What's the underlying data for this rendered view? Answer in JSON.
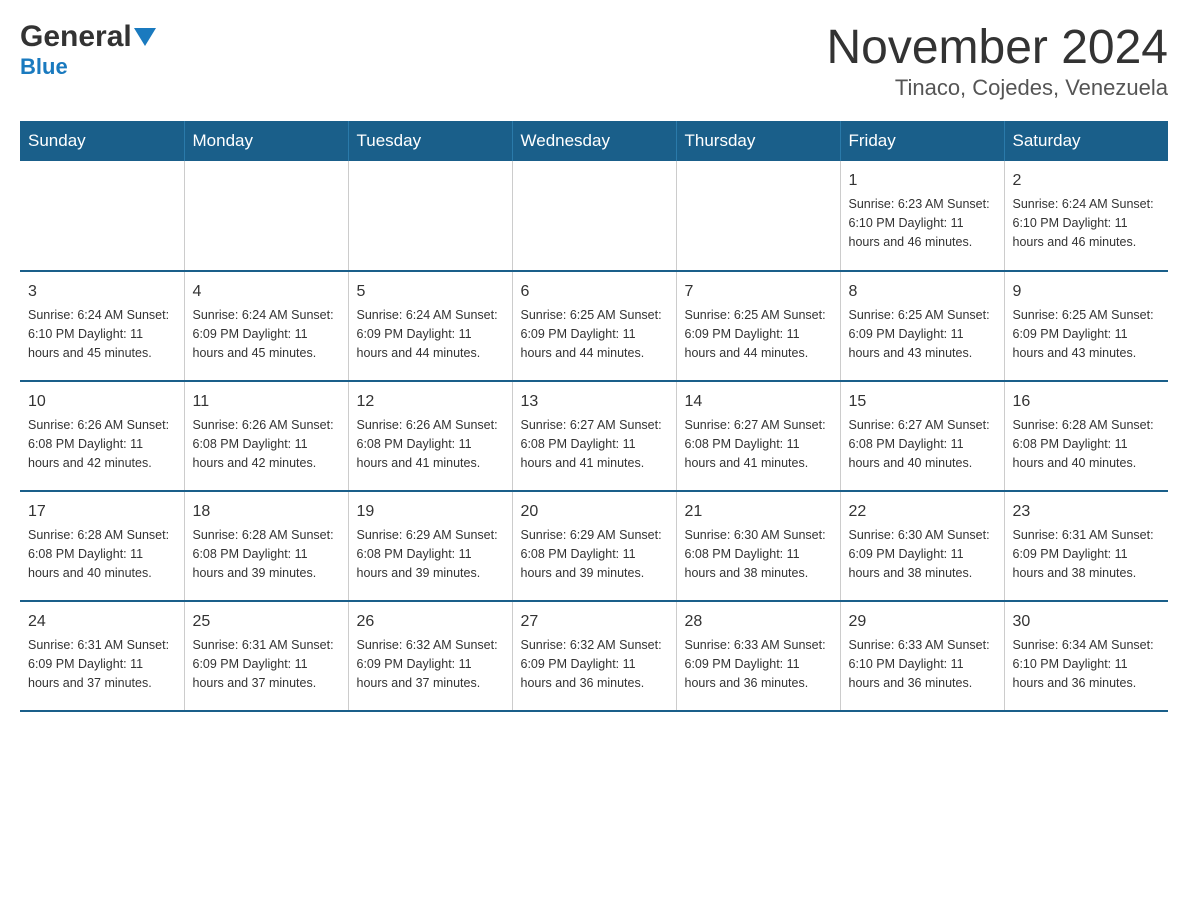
{
  "header": {
    "logo_general": "General",
    "logo_blue": "Blue",
    "month_year": "November 2024",
    "location": "Tinaco, Cojedes, Venezuela"
  },
  "days_of_week": [
    "Sunday",
    "Monday",
    "Tuesday",
    "Wednesday",
    "Thursday",
    "Friday",
    "Saturday"
  ],
  "weeks": [
    [
      {
        "day": "",
        "info": ""
      },
      {
        "day": "",
        "info": ""
      },
      {
        "day": "",
        "info": ""
      },
      {
        "day": "",
        "info": ""
      },
      {
        "day": "",
        "info": ""
      },
      {
        "day": "1",
        "info": "Sunrise: 6:23 AM\nSunset: 6:10 PM\nDaylight: 11 hours\nand 46 minutes."
      },
      {
        "day": "2",
        "info": "Sunrise: 6:24 AM\nSunset: 6:10 PM\nDaylight: 11 hours\nand 46 minutes."
      }
    ],
    [
      {
        "day": "3",
        "info": "Sunrise: 6:24 AM\nSunset: 6:10 PM\nDaylight: 11 hours\nand 45 minutes."
      },
      {
        "day": "4",
        "info": "Sunrise: 6:24 AM\nSunset: 6:09 PM\nDaylight: 11 hours\nand 45 minutes."
      },
      {
        "day": "5",
        "info": "Sunrise: 6:24 AM\nSunset: 6:09 PM\nDaylight: 11 hours\nand 44 minutes."
      },
      {
        "day": "6",
        "info": "Sunrise: 6:25 AM\nSunset: 6:09 PM\nDaylight: 11 hours\nand 44 minutes."
      },
      {
        "day": "7",
        "info": "Sunrise: 6:25 AM\nSunset: 6:09 PM\nDaylight: 11 hours\nand 44 minutes."
      },
      {
        "day": "8",
        "info": "Sunrise: 6:25 AM\nSunset: 6:09 PM\nDaylight: 11 hours\nand 43 minutes."
      },
      {
        "day": "9",
        "info": "Sunrise: 6:25 AM\nSunset: 6:09 PM\nDaylight: 11 hours\nand 43 minutes."
      }
    ],
    [
      {
        "day": "10",
        "info": "Sunrise: 6:26 AM\nSunset: 6:08 PM\nDaylight: 11 hours\nand 42 minutes."
      },
      {
        "day": "11",
        "info": "Sunrise: 6:26 AM\nSunset: 6:08 PM\nDaylight: 11 hours\nand 42 minutes."
      },
      {
        "day": "12",
        "info": "Sunrise: 6:26 AM\nSunset: 6:08 PM\nDaylight: 11 hours\nand 41 minutes."
      },
      {
        "day": "13",
        "info": "Sunrise: 6:27 AM\nSunset: 6:08 PM\nDaylight: 11 hours\nand 41 minutes."
      },
      {
        "day": "14",
        "info": "Sunrise: 6:27 AM\nSunset: 6:08 PM\nDaylight: 11 hours\nand 41 minutes."
      },
      {
        "day": "15",
        "info": "Sunrise: 6:27 AM\nSunset: 6:08 PM\nDaylight: 11 hours\nand 40 minutes."
      },
      {
        "day": "16",
        "info": "Sunrise: 6:28 AM\nSunset: 6:08 PM\nDaylight: 11 hours\nand 40 minutes."
      }
    ],
    [
      {
        "day": "17",
        "info": "Sunrise: 6:28 AM\nSunset: 6:08 PM\nDaylight: 11 hours\nand 40 minutes."
      },
      {
        "day": "18",
        "info": "Sunrise: 6:28 AM\nSunset: 6:08 PM\nDaylight: 11 hours\nand 39 minutes."
      },
      {
        "day": "19",
        "info": "Sunrise: 6:29 AM\nSunset: 6:08 PM\nDaylight: 11 hours\nand 39 minutes."
      },
      {
        "day": "20",
        "info": "Sunrise: 6:29 AM\nSunset: 6:08 PM\nDaylight: 11 hours\nand 39 minutes."
      },
      {
        "day": "21",
        "info": "Sunrise: 6:30 AM\nSunset: 6:08 PM\nDaylight: 11 hours\nand 38 minutes."
      },
      {
        "day": "22",
        "info": "Sunrise: 6:30 AM\nSunset: 6:09 PM\nDaylight: 11 hours\nand 38 minutes."
      },
      {
        "day": "23",
        "info": "Sunrise: 6:31 AM\nSunset: 6:09 PM\nDaylight: 11 hours\nand 38 minutes."
      }
    ],
    [
      {
        "day": "24",
        "info": "Sunrise: 6:31 AM\nSunset: 6:09 PM\nDaylight: 11 hours\nand 37 minutes."
      },
      {
        "day": "25",
        "info": "Sunrise: 6:31 AM\nSunset: 6:09 PM\nDaylight: 11 hours\nand 37 minutes."
      },
      {
        "day": "26",
        "info": "Sunrise: 6:32 AM\nSunset: 6:09 PM\nDaylight: 11 hours\nand 37 minutes."
      },
      {
        "day": "27",
        "info": "Sunrise: 6:32 AM\nSunset: 6:09 PM\nDaylight: 11 hours\nand 36 minutes."
      },
      {
        "day": "28",
        "info": "Sunrise: 6:33 AM\nSunset: 6:09 PM\nDaylight: 11 hours\nand 36 minutes."
      },
      {
        "day": "29",
        "info": "Sunrise: 6:33 AM\nSunset: 6:10 PM\nDaylight: 11 hours\nand 36 minutes."
      },
      {
        "day": "30",
        "info": "Sunrise: 6:34 AM\nSunset: 6:10 PM\nDaylight: 11 hours\nand 36 minutes."
      }
    ]
  ]
}
